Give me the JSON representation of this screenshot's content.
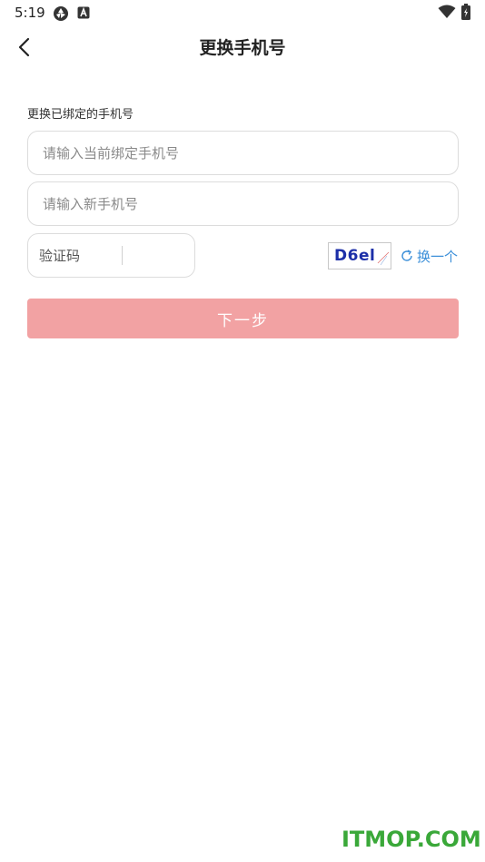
{
  "status_bar": {
    "time": "5:19",
    "icons": [
      "aperture-icon",
      "app-a-icon",
      "wifi-icon",
      "battery-icon"
    ]
  },
  "nav": {
    "back_icon": "chevron-left-icon",
    "title": "更换手机号"
  },
  "form": {
    "section_label": "更换已绑定的手机号",
    "current_phone": {
      "value": "",
      "placeholder": "请输入当前绑定手机号"
    },
    "new_phone": {
      "value": "",
      "placeholder": "请输入新手机号"
    },
    "captcha": {
      "value": "",
      "placeholder": "验证码"
    },
    "captcha_image_text": "D6el",
    "refresh_label": "换一个",
    "next_label": "下一步"
  },
  "watermark": "ITMOP.COM",
  "colors": {
    "accent_disabled": "#f2a2a3",
    "link": "#3b8fd9",
    "captcha_text": "#1c2fa8",
    "watermark": "#3aa839"
  }
}
